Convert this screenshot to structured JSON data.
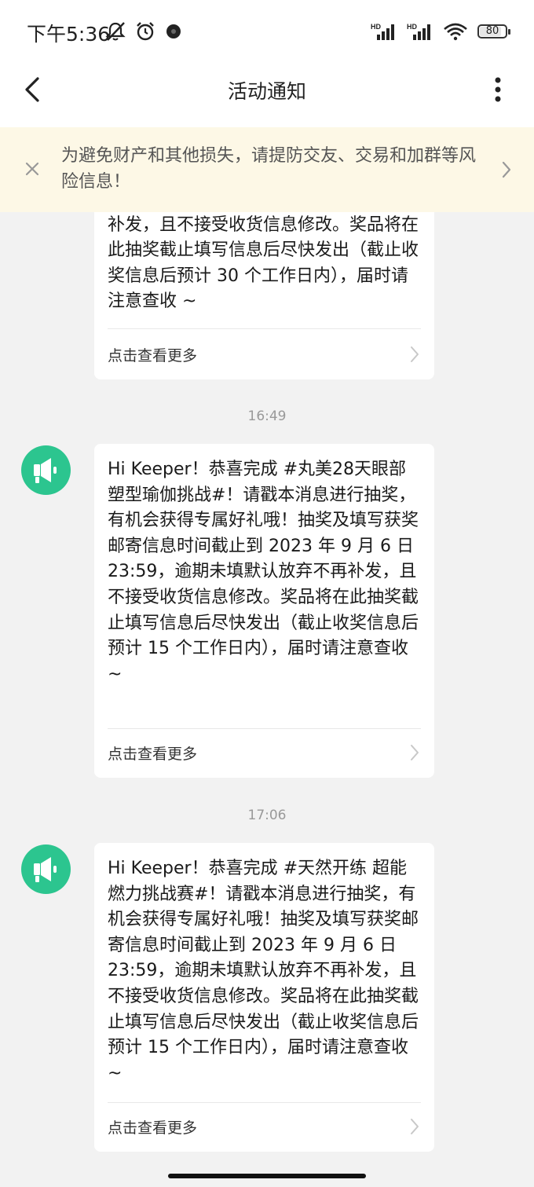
{
  "status_bar": {
    "time": "下午5:36",
    "icons_left": [
      "mute-icon",
      "alarm-icon",
      "app-notification-icon"
    ],
    "icons_right": [
      "signal-hd-icon",
      "signal-hd-icon",
      "wifi-icon"
    ],
    "battery": "80"
  },
  "nav": {
    "title": "活动通知"
  },
  "warning": {
    "text": "为避免财产和其他损失，请提防交友、交易和加群等风险信息！"
  },
  "messages": [
    {
      "text": "补发，且不接受收货信息修改。奖品将在此抽奖截止填写信息后尽快发出（截止收奖信息后预计 30 个工作日内），届时请注意查收 ~",
      "more_label": "点击查看更多"
    },
    {
      "time": "16:49",
      "text": "Hi Keeper！恭喜完成 #丸美28天眼部塑型瑜伽挑战#！请戳本消息进行抽奖，有机会获得专属好礼哦！抽奖及填写获奖邮寄信息时间截止到 2023 年 9 月 6 日 23:59，逾期未填默认放弃不再补发，且不接受收货信息修改。奖品将在此抽奖截止填写信息后尽快发出（截止收奖信息后预计 15 个工作日内），届时请注意查收 ~",
      "more_label": "点击查看更多"
    },
    {
      "time": "17:06",
      "text": "Hi Keeper！恭喜完成 #天然开练 超能燃力挑战赛#！请戳本消息进行抽奖，有机会获得专属好礼哦！抽奖及填写获奖邮寄信息时间截止到 2023 年 9 月 6 日 23:59，逾期未填默认放弃不再补发，且不接受收货信息修改。奖品将在此抽奖截止填写信息后尽快发出（截止收奖信息后预计 15 个工作日内），届时请注意查收 ~",
      "more_label": "点击查看更多"
    }
  ],
  "colors": {
    "accent": "#2cc58f",
    "banner_bg": "#fdf8e6",
    "page_bg": "#f2f2f2"
  }
}
